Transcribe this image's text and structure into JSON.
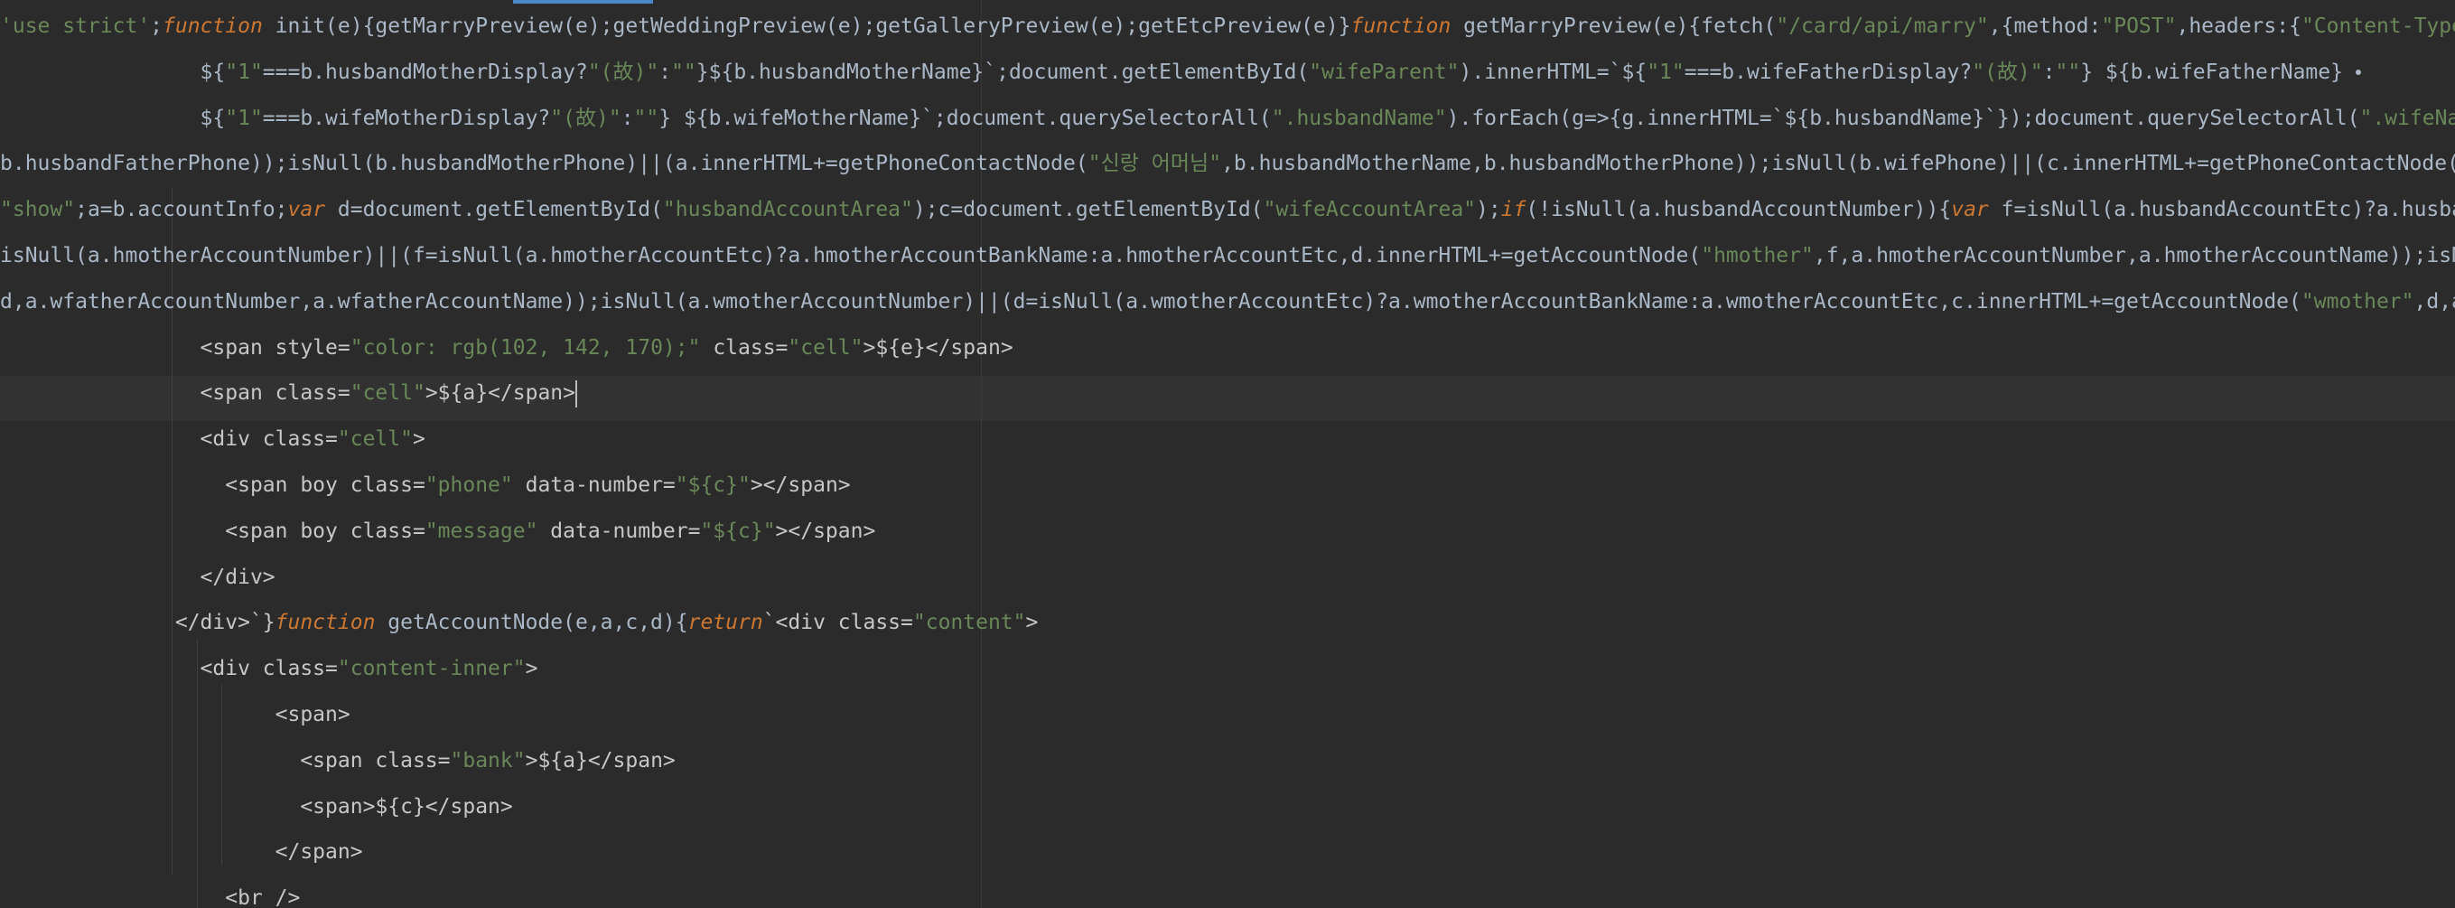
{
  "editor": {
    "lines": [
      [
        {
          "c": "str",
          "t": "'use strict'"
        },
        {
          "c": "pl",
          "t": ";"
        },
        {
          "c": "kw",
          "t": "function"
        },
        {
          "c": "pl",
          "t": " init(e){getMarryPreview(e);getWeddingPreview(e);getGalleryPreview(e);getEtcPreview(e)}"
        },
        {
          "c": "kw",
          "t": "function"
        },
        {
          "c": "pl",
          "t": " getMarryPreview(e){fetch("
        },
        {
          "c": "str",
          "t": "\"/card/api/marry\""
        },
        {
          "c": "pl",
          "t": ",{method:"
        },
        {
          "c": "str",
          "t": "\"POST\""
        },
        {
          "c": "pl",
          "t": ",headers:{"
        },
        {
          "c": "str",
          "t": "\"Content-Type\""
        }
      ],
      [
        {
          "c": "pl",
          "t": "                ${"
        },
        {
          "c": "str",
          "t": "\"1\""
        },
        {
          "c": "pl",
          "t": "===b.husbandMotherDisplay?"
        },
        {
          "c": "str",
          "t": "\"(故)\""
        },
        {
          "c": "pl",
          "t": ":"
        },
        {
          "c": "str",
          "t": "\"\""
        },
        {
          "c": "pl",
          "t": "}${b.husbandMotherName}`;document.getElementById("
        },
        {
          "c": "str",
          "t": "\"wifeParent\""
        },
        {
          "c": "pl",
          "t": ").innerHTML=`${"
        },
        {
          "c": "str",
          "t": "\"1\""
        },
        {
          "c": "pl",
          "t": "===b.wifeFatherDisplay?"
        },
        {
          "c": "str",
          "t": "\"(故)\""
        },
        {
          "c": "pl",
          "t": ":"
        },
        {
          "c": "str",
          "t": "\"\""
        },
        {
          "c": "pl",
          "t": "} ${b.wifeFatherName} "
        },
        {
          "c": "mark",
          "t": ""
        }
      ],
      [
        {
          "c": "pl",
          "t": "                ${"
        },
        {
          "c": "str",
          "t": "\"1\""
        },
        {
          "c": "pl",
          "t": "===b.wifeMotherDisplay?"
        },
        {
          "c": "str",
          "t": "\"(故)\""
        },
        {
          "c": "pl",
          "t": ":"
        },
        {
          "c": "str",
          "t": "\"\""
        },
        {
          "c": "pl",
          "t": "} ${b.wifeMotherName}`;document.querySelectorAll("
        },
        {
          "c": "str",
          "t": "\".husbandName\""
        },
        {
          "c": "pl",
          "t": ").forEach(g=>{g.innerHTML=`${b.husbandName}`});document.querySelectorAll("
        },
        {
          "c": "str",
          "t": "\".wifeName\""
        }
      ],
      [
        {
          "c": "pl",
          "t": "b.husbandFatherPhone));isNull(b.husbandMotherPhone)||(a.innerHTML+=getPhoneContactNode("
        },
        {
          "c": "str",
          "t": "\"신랑 어머님\""
        },
        {
          "c": "pl",
          "t": ",b.husbandMotherName,b.husbandMotherPhone));isNull(b.wifePhone)||(c.innerHTML+=getPhoneContactNode("
        },
        {
          "c": "str",
          "t": "\""
        }
      ],
      [
        {
          "c": "str",
          "t": "\"show\""
        },
        {
          "c": "pl",
          "t": ";a=b.accountInfo;"
        },
        {
          "c": "kw",
          "t": "var"
        },
        {
          "c": "pl",
          "t": " d=document.getElementById("
        },
        {
          "c": "str",
          "t": "\"husbandAccountArea\""
        },
        {
          "c": "pl",
          "t": ");c=document.getElementById("
        },
        {
          "c": "str",
          "t": "\"wifeAccountArea\""
        },
        {
          "c": "pl",
          "t": ");"
        },
        {
          "c": "kw",
          "t": "if"
        },
        {
          "c": "pl",
          "t": "(!isNull(a.husbandAccountNumber)){"
        },
        {
          "c": "kw",
          "t": "var"
        },
        {
          "c": "pl",
          "t": " f=isNull(a.husbandAccountEtc)?a.husbandA"
        }
      ],
      [
        {
          "c": "pl",
          "t": "isNull(a.hmotherAccountNumber)||(f=isNull(a.hmotherAccountEtc)?a.hmotherAccountBankName:a.hmotherAccountEtc,d.innerHTML+=getAccountNode("
        },
        {
          "c": "str",
          "t": "\"hmother\""
        },
        {
          "c": "pl",
          "t": ",f,a.hmotherAccountNumber,a.hmotherAccountName));isNull("
        }
      ],
      [
        {
          "c": "pl",
          "t": "d,a.wfatherAccountNumber,a.wfatherAccountName));isNull(a.wmotherAccountNumber)||(d=isNull(a.wmotherAccountEtc)?a.wmotherAccountBankName:a.wmotherAccountEtc,c.innerHTML+=getAccountNode("
        },
        {
          "c": "str",
          "t": "\"wmother\""
        },
        {
          "c": "pl",
          "t": ",d,a.wm"
        }
      ],
      [
        {
          "c": "tag",
          "t": "                <span style="
        },
        {
          "c": "str",
          "t": "\"color: rgb(102, 142, 170);\""
        },
        {
          "c": "tag",
          "t": " class="
        },
        {
          "c": "str",
          "t": "\"cell\""
        },
        {
          "c": "tag",
          "t": ">${e}</span>"
        }
      ],
      [
        {
          "c": "tag",
          "t": "                <span class="
        },
        {
          "c": "str",
          "t": "\"cell\""
        },
        {
          "c": "tag",
          "t": ">${a}</span>"
        },
        {
          "c": "cursor",
          "t": ""
        }
      ],
      [
        {
          "c": "tag",
          "t": "                <div class="
        },
        {
          "c": "str",
          "t": "\"cell\""
        },
        {
          "c": "tag",
          "t": ">"
        }
      ],
      [
        {
          "c": "tag",
          "t": "                  <span boy class="
        },
        {
          "c": "str",
          "t": "\"phone\""
        },
        {
          "c": "tag",
          "t": " data-number="
        },
        {
          "c": "str",
          "t": "\"${c}\""
        },
        {
          "c": "tag",
          "t": "></span>"
        }
      ],
      [
        {
          "c": "tag",
          "t": "                  <span boy class="
        },
        {
          "c": "str",
          "t": "\"message\""
        },
        {
          "c": "tag",
          "t": " data-number="
        },
        {
          "c": "str",
          "t": "\"${c}\""
        },
        {
          "c": "tag",
          "t": "></span>"
        }
      ],
      [
        {
          "c": "tag",
          "t": "                </div>"
        }
      ],
      [
        {
          "c": "tag",
          "t": "              </div>`}"
        },
        {
          "c": "kw",
          "t": "function"
        },
        {
          "c": "pl",
          "t": " getAccountNode(e,a,c,d){"
        },
        {
          "c": "kw",
          "t": "return"
        },
        {
          "c": "tag",
          "t": "`<div class="
        },
        {
          "c": "str",
          "t": "\"content\""
        },
        {
          "c": "tag",
          "t": ">"
        }
      ],
      [
        {
          "c": "tag",
          "t": "                <div class="
        },
        {
          "c": "str",
          "t": "\"content-inner\""
        },
        {
          "c": "tag",
          "t": ">"
        }
      ],
      [
        {
          "c": "tag",
          "t": "                      <span>"
        }
      ],
      [
        {
          "c": "tag",
          "t": "                        <span class="
        },
        {
          "c": "str",
          "t": "\"bank\""
        },
        {
          "c": "tag",
          "t": ">${a}</span>"
        }
      ],
      [
        {
          "c": "tag",
          "t": "                        <span>${c}</span>"
        }
      ],
      [
        {
          "c": "tag",
          "t": "                      </span>"
        }
      ],
      [
        {
          "c": "tag",
          "t": "                  <br />"
        }
      ]
    ]
  }
}
